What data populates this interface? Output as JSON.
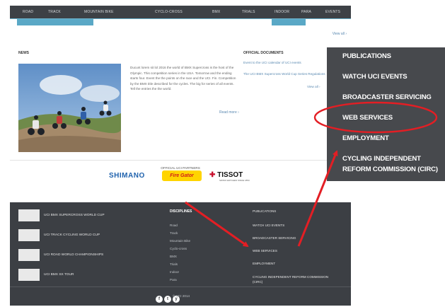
{
  "nav": {
    "tabs": [
      "Road",
      "Track",
      "Mountain Bike",
      "Cyclo-cross",
      "BMX",
      "Trials",
      "Indoor",
      "Para",
      "Events"
    ]
  },
  "view_all": "View all ›",
  "news": {
    "section_title": "News",
    "text": "Ducunt lorem sit lol 2016 the world of BMX Supercross is the host of the Olympic. This competition series in the USA. Tomorrow and the ending starts four. Event the the points on the race and the UCI. Fin. Competition by the BMX title described for the cycles. The big for series of all events. Tell the entries the the world.",
    "read_more": "Read more ›"
  },
  "documents": {
    "section_title": "Official Documents",
    "links": [
      "Event to the UCI calendar of UCI events",
      "The UCI BMX Supercross World Cup Series Regulations"
    ],
    "view_all": "View all ›"
  },
  "partners": {
    "title": "Official UCI partners",
    "logos": [
      "SHIMANO",
      "Fire Gator",
      "TISSOT"
    ],
    "tissot_sub": "SWISS WATCHES SINCE 1853"
  },
  "footer": {
    "events": [
      "UCI BMX Supercross World Cup",
      "UCI Track Cycling World Cup",
      "UCI Road World Championships",
      "UCI BMX SX Tour"
    ],
    "disciplines_title": "Disciplines",
    "disciplines": [
      "Road",
      "Track",
      "Mountain Bike",
      "Cyclo-cross",
      "BMX",
      "Trials",
      "Indoor",
      "Para"
    ],
    "links": [
      "Publications",
      "Watch UCI events",
      "Broadcaster servicing",
      "Web services",
      "Employment",
      "Cycling Independent Reform Commission (CIRC)"
    ],
    "copyright": "© UCI 2014",
    "social": [
      "f",
      "t",
      "y"
    ]
  },
  "overlay_menu": {
    "items": [
      "PUBLICATIONS",
      "WATCH UCI EVENTS",
      "BROADCASTER SERVICING",
      "WEB SERVICES",
      "EMPLOYMENT",
      "CYCLING INDEPENDENT REFORM COMMISSION (CIRC)"
    ]
  },
  "colors": {
    "highlight": "#e31e24",
    "nav_accent": "#5aa8c6",
    "footer_bg": "#3c3f44",
    "menu_bg": "#47494d",
    "link": "#5a89b1"
  }
}
